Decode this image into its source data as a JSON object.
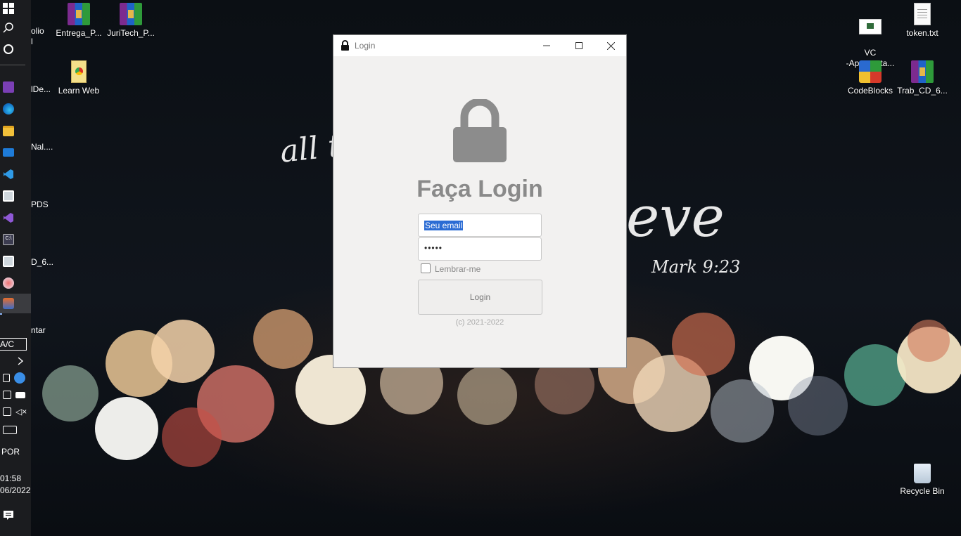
{
  "desktop": {
    "left_icons": [
      {
        "label": "olio\nl"
      },
      {
        "label": "lDe..."
      },
      {
        "label": "Nal...."
      },
      {
        "label": "PDS"
      },
      {
        "label": "D_6..."
      },
      {
        "label": "ntar"
      }
    ],
    "top_icons": [
      {
        "label": "Entrega_P..."
      },
      {
        "label": "JuriTech_P..."
      },
      {
        "label": "Learn Web"
      }
    ],
    "right_icons": [
      {
        "label": "VC\n-Apresenta..."
      },
      {
        "label": "token.txt"
      },
      {
        "label": "CodeBlocks"
      },
      {
        "label": "Trab_CD_6..."
      },
      {
        "label": "Recycle Bin"
      }
    ],
    "wallpaper_text": {
      "left": "all th",
      "right": "eve",
      "verse": "Mark 9:23"
    }
  },
  "taskbar": {
    "power_label": "A/C",
    "language": "POR",
    "time": "01:58",
    "date": "06/2022"
  },
  "window": {
    "title": "Login",
    "heading": "Faça Login",
    "email_value": "Seu email",
    "password_value": "•••••",
    "remember_label": "Lembrar-me",
    "login_button": "Login",
    "copyright": "(c) 2021-2022",
    "controls": {
      "minimize": "—",
      "maximize": "☐",
      "close": "✕"
    }
  },
  "colors": {
    "heading": "#8a8a8a",
    "selection": "#2b6cd4",
    "window_bg": "#f2f1f0"
  }
}
